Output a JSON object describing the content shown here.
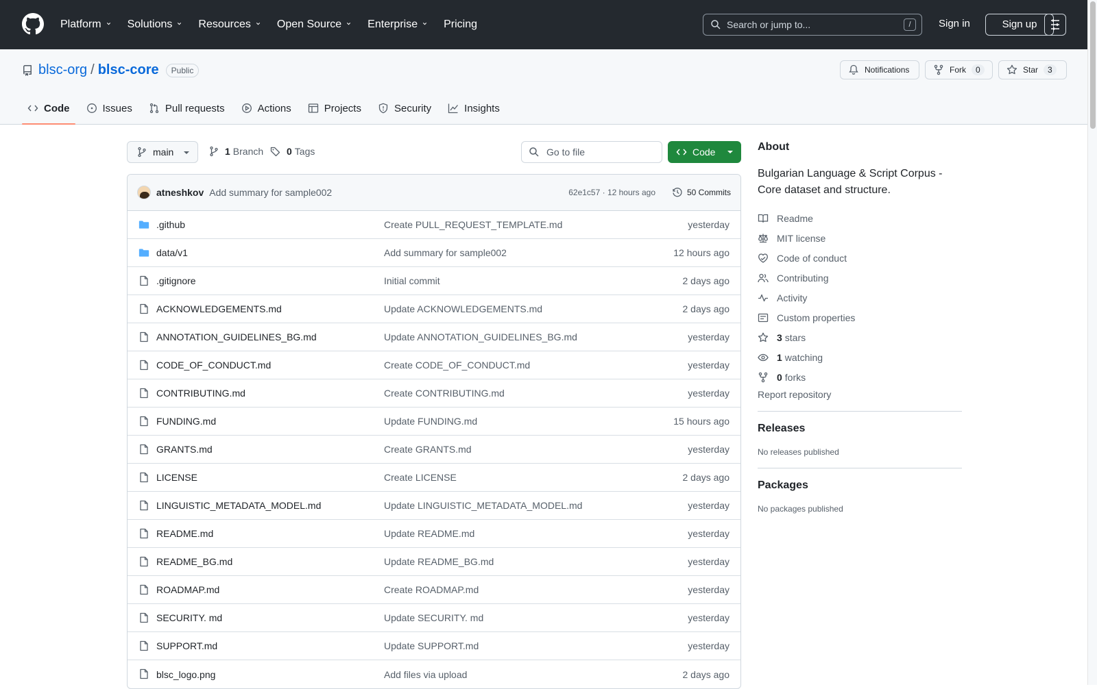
{
  "topnav": {
    "items": [
      {
        "label": "Platform",
        "has_menu": true
      },
      {
        "label": "Solutions",
        "has_menu": true
      },
      {
        "label": "Resources",
        "has_menu": true
      },
      {
        "label": "Open Source",
        "has_menu": true
      },
      {
        "label": "Enterprise",
        "has_menu": true
      },
      {
        "label": "Pricing",
        "has_menu": false
      }
    ],
    "search_placeholder": "Search or jump to...",
    "search_shortcut": "/",
    "signin": "Sign in",
    "signup": "Sign up"
  },
  "repo": {
    "owner": "blsc-org",
    "separator": "/",
    "name": "blsc-core",
    "visibility": "Public",
    "notifications": "Notifications",
    "fork_label": "Fork",
    "fork_count": "0",
    "star_label": "Star",
    "star_count": "3"
  },
  "tabs": [
    {
      "label": "Code",
      "icon": "code-icon",
      "active": true
    },
    {
      "label": "Issues",
      "icon": "issue-icon",
      "active": false
    },
    {
      "label": "Pull requests",
      "icon": "pull-request-icon",
      "active": false
    },
    {
      "label": "Actions",
      "icon": "play-icon",
      "active": false
    },
    {
      "label": "Projects",
      "icon": "table-icon",
      "active": false
    },
    {
      "label": "Security",
      "icon": "shield-icon",
      "active": false
    },
    {
      "label": "Insights",
      "icon": "graph-icon",
      "active": false
    }
  ],
  "toolbar": {
    "branch": "main",
    "branch_count": "1",
    "branch_label": "Branch",
    "tag_count": "0",
    "tag_label": "Tags",
    "goto_placeholder": "Go to file",
    "code_button": "Code"
  },
  "latest_commit": {
    "author": "atneshkov",
    "message": "Add summary for sample002",
    "sha_time": "62e1c57 · 12 hours ago",
    "commits": "50 Commits"
  },
  "files": [
    {
      "type": "dir",
      "name": ".github",
      "message": "Create PULL_REQUEST_TEMPLATE.md",
      "date": "yesterday"
    },
    {
      "type": "dir",
      "name": "data/v1",
      "message": "Add summary for sample002",
      "date": "12 hours ago"
    },
    {
      "type": "file",
      "name": ".gitignore",
      "message": "Initial commit",
      "date": "2 days ago"
    },
    {
      "type": "file",
      "name": "ACKNOWLEDGEMENTS.md",
      "message": "Update ACKNOWLEDGEMENTS.md",
      "date": "2 days ago"
    },
    {
      "type": "file",
      "name": "ANNOTATION_GUIDELINES_BG.md",
      "message": "Update ANNOTATION_GUIDELINES_BG.md",
      "date": "yesterday"
    },
    {
      "type": "file",
      "name": "CODE_OF_CONDUCT.md",
      "message": "Create CODE_OF_CONDUCT.md",
      "date": "yesterday"
    },
    {
      "type": "file",
      "name": "CONTRIBUTING.md",
      "message": "Create CONTRIBUTING.md",
      "date": "yesterday"
    },
    {
      "type": "file",
      "name": "FUNDING.md",
      "message": "Update FUNDING.md",
      "date": "15 hours ago"
    },
    {
      "type": "file",
      "name": "GRANTS.md",
      "message": "Create GRANTS.md",
      "date": "yesterday"
    },
    {
      "type": "file",
      "name": "LICENSE",
      "message": "Create LICENSE",
      "date": "2 days ago"
    },
    {
      "type": "file",
      "name": "LINGUISTIC_METADATA_MODEL.md",
      "message": "Update LINGUISTIC_METADATA_MODEL.md",
      "date": "yesterday"
    },
    {
      "type": "file",
      "name": "README.md",
      "message": "Update README.md",
      "date": "yesterday"
    },
    {
      "type": "file",
      "name": "README_BG.md",
      "message": "Update README_BG.md",
      "date": "yesterday"
    },
    {
      "type": "file",
      "name": "ROADMAP.md",
      "message": "Create ROADMAP.md",
      "date": "yesterday"
    },
    {
      "type": "file",
      "name": "SECURITY. md",
      "message": "Update SECURITY. md",
      "date": "yesterday"
    },
    {
      "type": "file",
      "name": "SUPPORT.md",
      "message": "Update SUPPORT.md",
      "date": "yesterday"
    },
    {
      "type": "file",
      "name": "blsc_logo.png",
      "message": "Add files via upload",
      "date": "2 days ago"
    }
  ],
  "about": {
    "title": "About",
    "description": "Bulgarian Language & Script Corpus - Core dataset and structure.",
    "links": [
      {
        "icon": "book-icon",
        "count": "",
        "label": "Readme"
      },
      {
        "icon": "law-icon",
        "count": "",
        "label": "MIT license"
      },
      {
        "icon": "heart-icon",
        "count": "",
        "label": "Code of conduct"
      },
      {
        "icon": "people-icon",
        "count": "",
        "label": "Contributing"
      },
      {
        "icon": "pulse-icon",
        "count": "",
        "label": "Activity"
      },
      {
        "icon": "note-icon",
        "count": "",
        "label": "Custom properties"
      },
      {
        "icon": "star-icon",
        "count": "3",
        "label": "stars"
      },
      {
        "icon": "eye-icon",
        "count": "1",
        "label": "watching"
      },
      {
        "icon": "fork-icon",
        "count": "0",
        "label": "forks"
      }
    ],
    "report": "Report repository"
  },
  "releases": {
    "title": "Releases",
    "subtitle": "No releases published"
  },
  "packages": {
    "title": "Packages",
    "subtitle": "No packages published"
  },
  "colors": {
    "header_bg": "#24292f",
    "link": "#0969da",
    "code_button": "#1f883d",
    "folder": "#54aeff",
    "active_tab": "#fd8c73"
  }
}
